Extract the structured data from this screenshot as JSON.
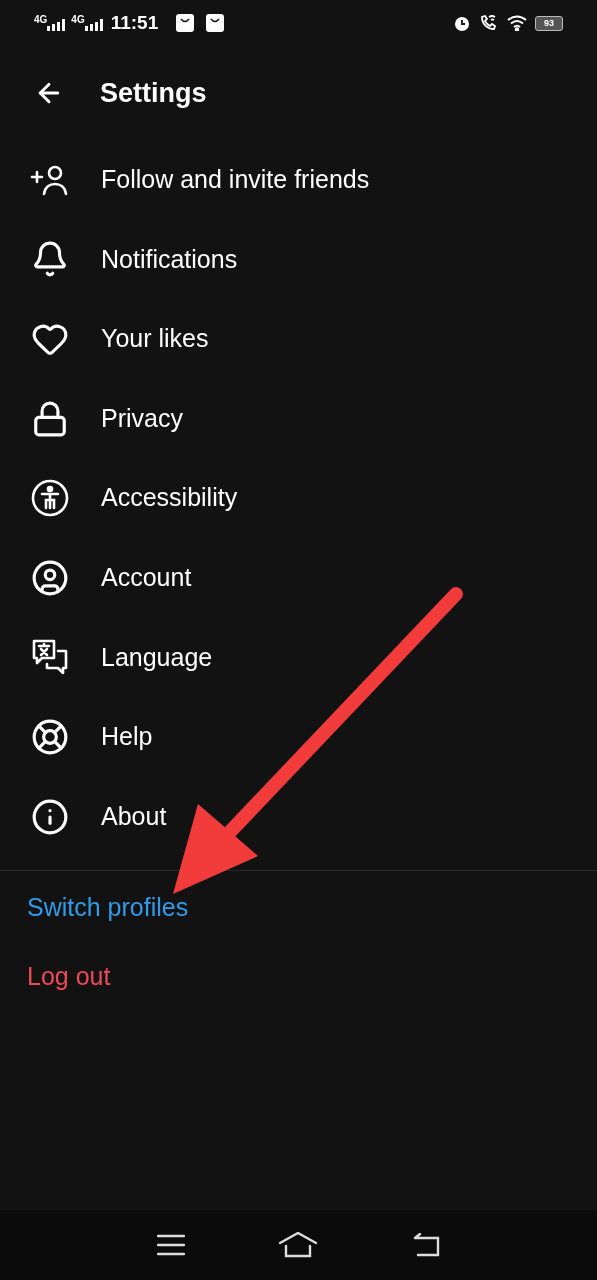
{
  "status_bar": {
    "networks": [
      "4G",
      "4G"
    ],
    "time": "11:51",
    "battery": "93"
  },
  "header": {
    "title": "Settings"
  },
  "items": [
    {
      "kind": "follow",
      "label": "Follow and invite friends"
    },
    {
      "kind": "notifications",
      "label": "Notifications"
    },
    {
      "kind": "likes",
      "label": "Your likes"
    },
    {
      "kind": "privacy",
      "label": "Privacy"
    },
    {
      "kind": "accessibility",
      "label": "Accessibility"
    },
    {
      "kind": "account",
      "label": "Account"
    },
    {
      "kind": "language",
      "label": "Language"
    },
    {
      "kind": "help",
      "label": "Help"
    },
    {
      "kind": "about",
      "label": "About"
    }
  ],
  "actions": [
    {
      "kind": "link",
      "label": "Switch profiles"
    },
    {
      "kind": "danger",
      "label": "Log out"
    }
  ]
}
